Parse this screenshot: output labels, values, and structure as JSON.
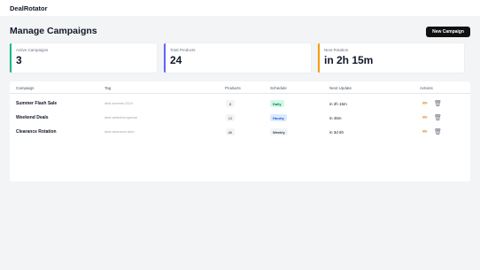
{
  "app": {
    "title": "DealRotator"
  },
  "header": {
    "title": "Manage Campaigns",
    "new_button_label": "New Campaign"
  },
  "stats": [
    {
      "label": "Active Campaigns",
      "value": "3",
      "accent": "#10b981"
    },
    {
      "label": "Total Products",
      "value": "24",
      "accent": "#6366f1"
    },
    {
      "label": "Next Rotation",
      "value": "in 2h 15m",
      "accent": "#f59e0b"
    }
  ],
  "table": {
    "columns": [
      "Campaign",
      "Tag",
      "Products",
      "Schedule",
      "Next Update",
      "Actions"
    ],
    "rows": [
      {
        "campaign": "Summer Flash Sale",
        "tag": "deal-summer-2024",
        "products": "8",
        "schedule": "Daily",
        "next_update": "in 2h 15m"
      },
      {
        "campaign": "Weekend Deals",
        "tag": "deal-weekend-special",
        "products": "12",
        "schedule": "Hourly",
        "next_update": "in 45m"
      },
      {
        "campaign": "Clearance Rotation",
        "tag": "deal-clearance-auto",
        "products": "All",
        "schedule": "Weekly",
        "next_update": "in 3d 6h"
      }
    ],
    "action_icons": [
      "pencil-icon",
      "trash-icon"
    ]
  }
}
